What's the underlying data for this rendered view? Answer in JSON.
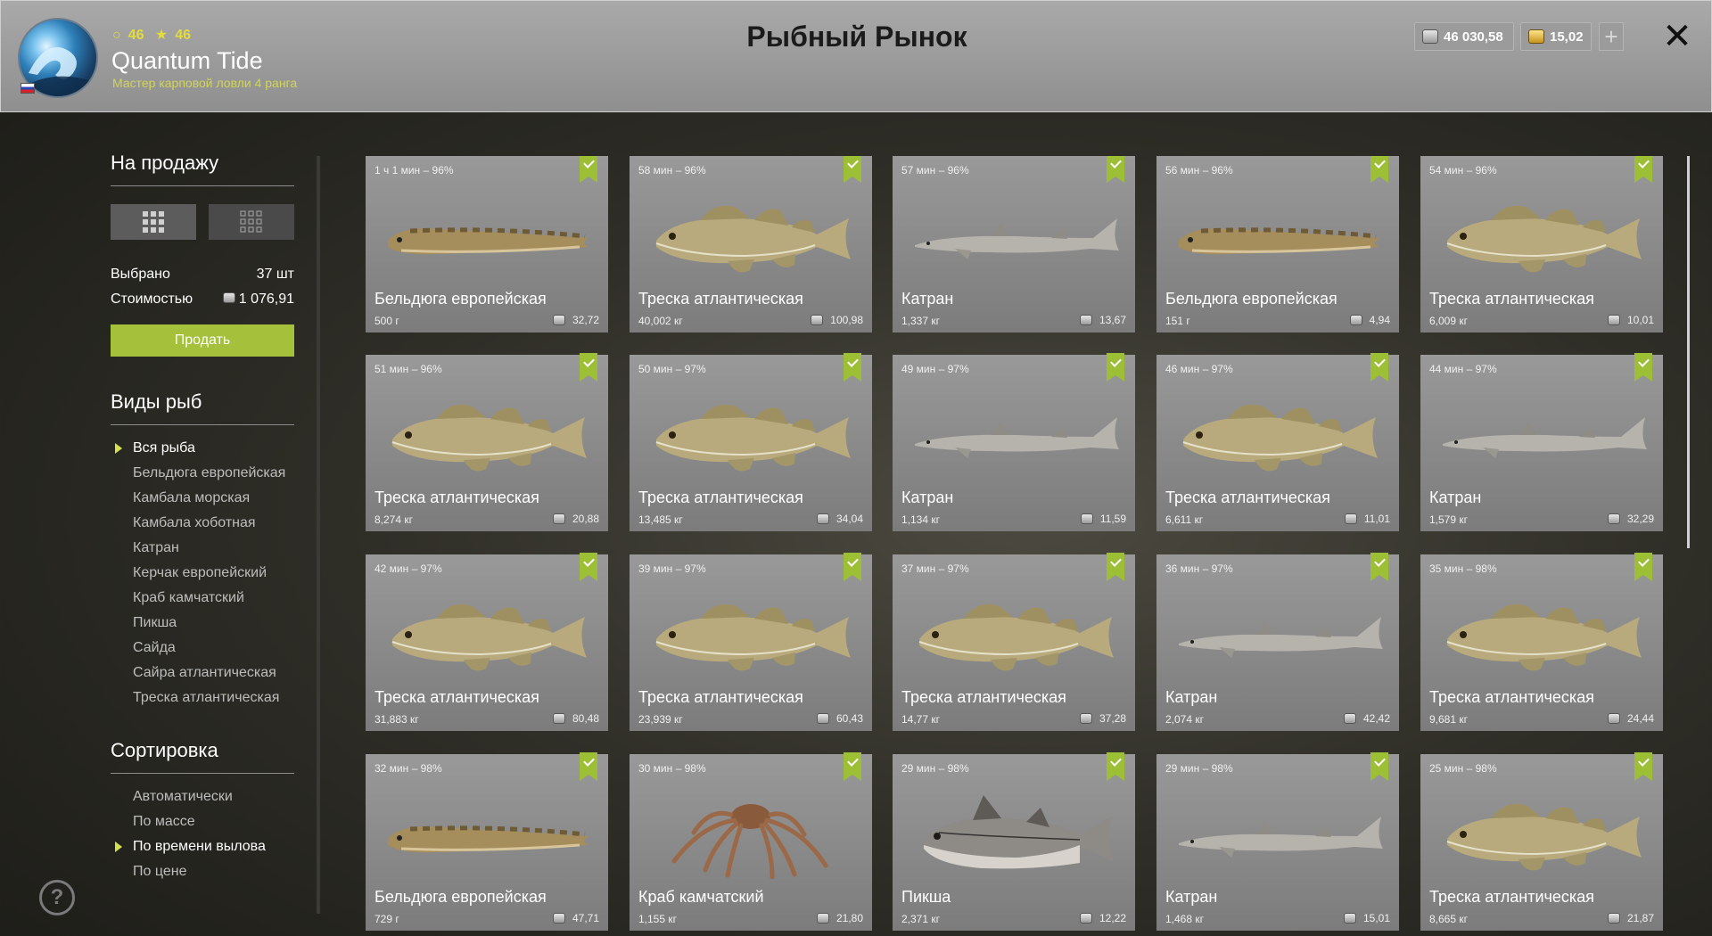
{
  "header": {
    "level": "46",
    "rank_level": "46",
    "player_name": "Quantum Tide",
    "player_title": "Мастер карповой ловли 4 ранга",
    "page_title": "Рыбный Рынок",
    "silver": "46 030,58",
    "gold": "15,02",
    "plus": "+",
    "close": "✕"
  },
  "sidebar": {
    "for_sale_heading": "На продажу",
    "selected_label": "Выбрано",
    "selected_value": "37 шт",
    "cost_label": "Стоимостью",
    "cost_value": "1 076,91",
    "sell_button": "Продать",
    "fish_types_heading": "Виды рыб",
    "fish_types": [
      "Вся рыба",
      "Бельдюга европейская",
      "Камбала морская",
      "Камбала хоботная",
      "Катран",
      "Керчак европейский",
      "Краб камчатский",
      "Пикша",
      "Сайда",
      "Сайра атлантическая",
      "Треска атлантическая"
    ],
    "fish_types_active": 0,
    "sort_heading": "Сортировка",
    "sort_options": [
      "Автоматически",
      "По массе",
      "По времени вылова",
      "По цене"
    ],
    "sort_active": 2,
    "help": "?"
  },
  "colors": {
    "accent_green": "#a5c03b",
    "check_green": "#9dbf36",
    "header_bg": "#9f9f9f"
  },
  "cards": [
    {
      "time": "1 ч 1 мин – 96%",
      "name": "Бельдюга европейская",
      "weight": "500 г",
      "price": "32,72",
      "kind": "eelpout"
    },
    {
      "time": "58 мин – 96%",
      "name": "Треска атлантическая",
      "weight": "40,002 кг",
      "price": "100,98",
      "kind": "cod"
    },
    {
      "time": "57 мин – 96%",
      "name": "Катран",
      "weight": "1,337 кг",
      "price": "13,67",
      "kind": "shark"
    },
    {
      "time": "56 мин – 96%",
      "name": "Бельдюга европейская",
      "weight": "151 г",
      "price": "4,94",
      "kind": "eelpout"
    },
    {
      "time": "54 мин – 96%",
      "name": "Треска атлантическая",
      "weight": "6,009 кг",
      "price": "10,01",
      "kind": "cod"
    },
    {
      "time": "51 мин – 96%",
      "name": "Треска атлантическая",
      "weight": "8,274 кг",
      "price": "20,88",
      "kind": "cod"
    },
    {
      "time": "50 мин – 97%",
      "name": "Треска атлантическая",
      "weight": "13,485 кг",
      "price": "34,04",
      "kind": "cod"
    },
    {
      "time": "49 мин – 97%",
      "name": "Катран",
      "weight": "1,134 кг",
      "price": "11,59",
      "kind": "shark"
    },
    {
      "time": "46 мин – 97%",
      "name": "Треска атлантическая",
      "weight": "6,611 кг",
      "price": "11,01",
      "kind": "cod"
    },
    {
      "time": "44 мин – 97%",
      "name": "Катран",
      "weight": "1,579 кг",
      "price": "32,29",
      "kind": "shark"
    },
    {
      "time": "42 мин – 97%",
      "name": "Треска атлантическая",
      "weight": "31,883 кг",
      "price": "80,48",
      "kind": "cod"
    },
    {
      "time": "39 мин – 97%",
      "name": "Треска атлантическая",
      "weight": "23,939 кг",
      "price": "60,43",
      "kind": "cod"
    },
    {
      "time": "37 мин – 97%",
      "name": "Треска атлантическая",
      "weight": "14,77 кг",
      "price": "37,28",
      "kind": "cod"
    },
    {
      "time": "36 мин – 97%",
      "name": "Катран",
      "weight": "2,074 кг",
      "price": "42,42",
      "kind": "shark"
    },
    {
      "time": "35 мин – 98%",
      "name": "Треска атлантическая",
      "weight": "9,681 кг",
      "price": "24,44",
      "kind": "cod"
    },
    {
      "time": "32 мин – 98%",
      "name": "Бельдюга европейская",
      "weight": "729 г",
      "price": "47,71",
      "kind": "eelpout"
    },
    {
      "time": "30 мин – 98%",
      "name": "Краб камчатский",
      "weight": "1,155 кг",
      "price": "21,80",
      "kind": "crab"
    },
    {
      "time": "29 мин – 98%",
      "name": "Пикша",
      "weight": "2,371 кг",
      "price": "12,22",
      "kind": "haddock"
    },
    {
      "time": "29 мин – 98%",
      "name": "Катран",
      "weight": "1,468 кг",
      "price": "15,01",
      "kind": "shark"
    },
    {
      "time": "25 мин – 98%",
      "name": "Треска атлантическая",
      "weight": "8,665 кг",
      "price": "21,87",
      "kind": "cod"
    }
  ]
}
